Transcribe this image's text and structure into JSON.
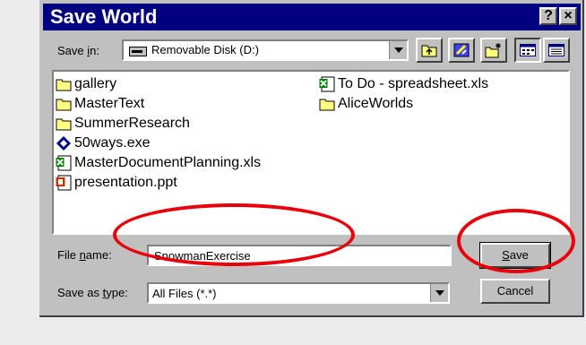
{
  "window": {
    "title": "Save World",
    "help_glyph": "?",
    "close_glyph": "×"
  },
  "save_in": {
    "label_pre": "Save ",
    "label_key": "i",
    "label_post": "n:",
    "value": "Removable Disk (D:)"
  },
  "toolbar": {
    "icons": [
      "up-folder-icon",
      "desktop-icon",
      "new-folder-icon",
      "list-view-icon",
      "details-view-icon"
    ]
  },
  "files": [
    {
      "name": "gallery",
      "icon": "folder-icon"
    },
    {
      "name": "MasterText",
      "icon": "folder-icon"
    },
    {
      "name": "SummerResearch",
      "icon": "folder-icon"
    },
    {
      "name": "50ways.exe",
      "icon": "exe-icon"
    },
    {
      "name": "MasterDocumentPlanning.xls",
      "icon": "excel-icon"
    },
    {
      "name": "presentation.ppt",
      "icon": "powerpoint-icon"
    },
    {
      "name": "To Do - spreadsheet.xls",
      "icon": "excel-icon"
    },
    {
      "name": "AliceWorlds",
      "icon": "folder-icon"
    }
  ],
  "file_name": {
    "label_pre": "File ",
    "label_key": "n",
    "label_post": "ame:",
    "value": "SnowmanExercise"
  },
  "save_as_type": {
    "label_pre": "Save as ",
    "label_key": "t",
    "label_post": "ype:",
    "value": "All Files (*.*)"
  },
  "buttons": {
    "save_key": "S",
    "save_rest": "ave",
    "cancel": "Cancel"
  },
  "colors": {
    "title_bar": "#000080",
    "dialog_bg": "#c0c0c0",
    "annotation": "#e8000a"
  }
}
